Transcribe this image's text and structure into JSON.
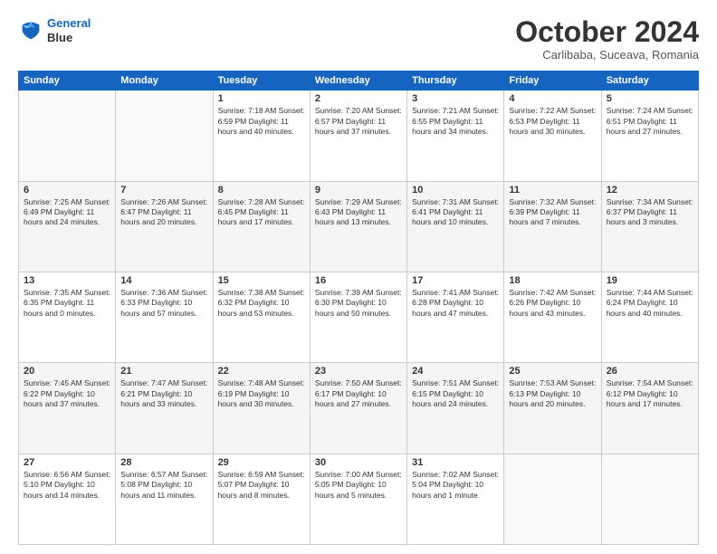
{
  "header": {
    "logo_line1": "General",
    "logo_line2": "Blue",
    "month_title": "October 2024",
    "location": "Carlibaba, Suceava, Romania"
  },
  "weekdays": [
    "Sunday",
    "Monday",
    "Tuesday",
    "Wednesday",
    "Thursday",
    "Friday",
    "Saturday"
  ],
  "weeks": [
    [
      {
        "day": "",
        "info": ""
      },
      {
        "day": "",
        "info": ""
      },
      {
        "day": "1",
        "info": "Sunrise: 7:18 AM\nSunset: 6:59 PM\nDaylight: 11 hours and 40 minutes."
      },
      {
        "day": "2",
        "info": "Sunrise: 7:20 AM\nSunset: 6:57 PM\nDaylight: 11 hours and 37 minutes."
      },
      {
        "day": "3",
        "info": "Sunrise: 7:21 AM\nSunset: 6:55 PM\nDaylight: 11 hours and 34 minutes."
      },
      {
        "day": "4",
        "info": "Sunrise: 7:22 AM\nSunset: 6:53 PM\nDaylight: 11 hours and 30 minutes."
      },
      {
        "day": "5",
        "info": "Sunrise: 7:24 AM\nSunset: 6:51 PM\nDaylight: 11 hours and 27 minutes."
      }
    ],
    [
      {
        "day": "6",
        "info": "Sunrise: 7:25 AM\nSunset: 6:49 PM\nDaylight: 11 hours and 24 minutes."
      },
      {
        "day": "7",
        "info": "Sunrise: 7:26 AM\nSunset: 6:47 PM\nDaylight: 11 hours and 20 minutes."
      },
      {
        "day": "8",
        "info": "Sunrise: 7:28 AM\nSunset: 6:45 PM\nDaylight: 11 hours and 17 minutes."
      },
      {
        "day": "9",
        "info": "Sunrise: 7:29 AM\nSunset: 6:43 PM\nDaylight: 11 hours and 13 minutes."
      },
      {
        "day": "10",
        "info": "Sunrise: 7:31 AM\nSunset: 6:41 PM\nDaylight: 11 hours and 10 minutes."
      },
      {
        "day": "11",
        "info": "Sunrise: 7:32 AM\nSunset: 6:39 PM\nDaylight: 11 hours and 7 minutes."
      },
      {
        "day": "12",
        "info": "Sunrise: 7:34 AM\nSunset: 6:37 PM\nDaylight: 11 hours and 3 minutes."
      }
    ],
    [
      {
        "day": "13",
        "info": "Sunrise: 7:35 AM\nSunset: 6:35 PM\nDaylight: 11 hours and 0 minutes."
      },
      {
        "day": "14",
        "info": "Sunrise: 7:36 AM\nSunset: 6:33 PM\nDaylight: 10 hours and 57 minutes."
      },
      {
        "day": "15",
        "info": "Sunrise: 7:38 AM\nSunset: 6:32 PM\nDaylight: 10 hours and 53 minutes."
      },
      {
        "day": "16",
        "info": "Sunrise: 7:39 AM\nSunset: 6:30 PM\nDaylight: 10 hours and 50 minutes."
      },
      {
        "day": "17",
        "info": "Sunrise: 7:41 AM\nSunset: 6:28 PM\nDaylight: 10 hours and 47 minutes."
      },
      {
        "day": "18",
        "info": "Sunrise: 7:42 AM\nSunset: 6:26 PM\nDaylight: 10 hours and 43 minutes."
      },
      {
        "day": "19",
        "info": "Sunrise: 7:44 AM\nSunset: 6:24 PM\nDaylight: 10 hours and 40 minutes."
      }
    ],
    [
      {
        "day": "20",
        "info": "Sunrise: 7:45 AM\nSunset: 6:22 PM\nDaylight: 10 hours and 37 minutes."
      },
      {
        "day": "21",
        "info": "Sunrise: 7:47 AM\nSunset: 6:21 PM\nDaylight: 10 hours and 33 minutes."
      },
      {
        "day": "22",
        "info": "Sunrise: 7:48 AM\nSunset: 6:19 PM\nDaylight: 10 hours and 30 minutes."
      },
      {
        "day": "23",
        "info": "Sunrise: 7:50 AM\nSunset: 6:17 PM\nDaylight: 10 hours and 27 minutes."
      },
      {
        "day": "24",
        "info": "Sunrise: 7:51 AM\nSunset: 6:15 PM\nDaylight: 10 hours and 24 minutes."
      },
      {
        "day": "25",
        "info": "Sunrise: 7:53 AM\nSunset: 6:13 PM\nDaylight: 10 hours and 20 minutes."
      },
      {
        "day": "26",
        "info": "Sunrise: 7:54 AM\nSunset: 6:12 PM\nDaylight: 10 hours and 17 minutes."
      }
    ],
    [
      {
        "day": "27",
        "info": "Sunrise: 6:56 AM\nSunset: 5:10 PM\nDaylight: 10 hours and 14 minutes."
      },
      {
        "day": "28",
        "info": "Sunrise: 6:57 AM\nSunset: 5:08 PM\nDaylight: 10 hours and 11 minutes."
      },
      {
        "day": "29",
        "info": "Sunrise: 6:59 AM\nSunset: 5:07 PM\nDaylight: 10 hours and 8 minutes."
      },
      {
        "day": "30",
        "info": "Sunrise: 7:00 AM\nSunset: 5:05 PM\nDaylight: 10 hours and 5 minutes."
      },
      {
        "day": "31",
        "info": "Sunrise: 7:02 AM\nSunset: 5:04 PM\nDaylight: 10 hours and 1 minute."
      },
      {
        "day": "",
        "info": ""
      },
      {
        "day": "",
        "info": ""
      }
    ]
  ]
}
